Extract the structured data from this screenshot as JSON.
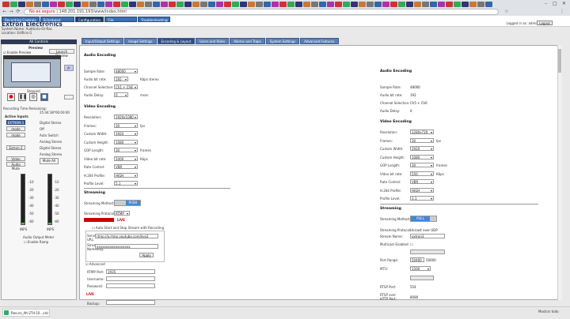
{
  "browser": {
    "security": "No es seguro",
    "url": "148.201.191.193/www/index.html"
  },
  "menubar": {
    "items": [
      "Recording Controls",
      "Scheduled Events",
      "Configuration",
      "File Management",
      "Troubleshooting"
    ],
    "active": "Configuration",
    "brand": "Extron Electronics",
    "logged_in": "Logged in as: admin",
    "logout": "Logout"
  },
  "system": {
    "name_label": "System Name:",
    "name_value": "Auditorio-Gt-Rac",
    "location_label": "Location:",
    "location_value": "Edificio G"
  },
  "subtabs": [
    "Input/Output Settings",
    "Image Settings",
    "Encoding & Layout",
    "Users and Roles",
    "Alarms and Traps",
    "System Settings",
    "Advanced Features"
  ],
  "subtabs_active": "Encoding & Layout",
  "sidebar": {
    "title": "All Controls",
    "preview_title": "Preview",
    "enable_preview": "Enable Preview",
    "launch_preview": "Launch Preview",
    "stopped": "Stopped",
    "rec_time_label": "Recording Time Remaining:",
    "rec_time_value": "25:44:38*00:00:00",
    "active_inputs": "Active Inputs",
    "input_rows": [
      {
        "btn": "EXTRON-1",
        "text": "Digital Stereo"
      },
      {
        "btn": "mode",
        "text": "Off"
      },
      {
        "btn": "mode",
        "text": "Auto Switch"
      },
      {
        "btn": "",
        "text": "Analog Stereo"
      },
      {
        "btn": "Extron-2",
        "text": "Digital Stereo"
      },
      {
        "btn": "",
        "text": "Analog Stereo"
      }
    ],
    "video_mute": "Video Mute",
    "audio_mute": "Audio Mute",
    "mute_all": "Mute All",
    "meter_scale": [
      "-10",
      "-20",
      "-30",
      "-40",
      "-50",
      "-60"
    ],
    "meter_labels": [
      "INPS",
      "INPS"
    ],
    "output_meter": "Audio Output Meter",
    "enable_ramp": "Enable Ramp",
    "meter_levels": [
      0.03,
      0.03
    ]
  },
  "left_enc": {
    "audio_title": "Audio Encoding",
    "audio": [
      {
        "label": "Sample Rate:",
        "value": "48000"
      },
      {
        "label": "Audio bit rate:",
        "value": "192",
        "unit": "Kbps stereo"
      },
      {
        "label": "Channel Selection:",
        "value": "Ch1 + Ch8"
      },
      {
        "label": "Audio Delay:",
        "value": "0",
        "unit": "msec"
      }
    ],
    "video_title": "Video Encoding",
    "video": [
      {
        "label": "Resolution:",
        "value": "1920x1080"
      },
      {
        "label": "Frames:",
        "value": "30",
        "unit": "fps"
      },
      {
        "label": "Custom Width:",
        "value": "1920"
      },
      {
        "label": "Custom Height:",
        "value": "1080"
      },
      {
        "label": "GOP Length:",
        "value": "30",
        "unit": "frames"
      },
      {
        "label": "Video bit rate:",
        "value": "5000",
        "unit": "Kbps"
      },
      {
        "label": "Rate Control:",
        "value": "VBR"
      },
      {
        "label": "H.264 Profile:",
        "value": "HIGH"
      },
      {
        "label": "Profile Level:",
        "value": "5.1"
      }
    ],
    "stream_title": "Streaming",
    "stream_method_label": "Streaming Method:",
    "stream_method": "PUSH",
    "stream_protocol_label": "Streaming Protocol:",
    "stream_protocol": "RTMP",
    "live_badge": "LIVE",
    "auto_start": "Auto Start and Stop Stream with Recording",
    "server_label": "Server URL:",
    "server_value": "rtmp://a.rtmp.youtube.com/live2",
    "stream_name_label": "Stream Name/Key:",
    "stream_name_value": "xxxxxxxxxxxxxxxxxx",
    "apply": "Apply",
    "advanced": "Advanced",
    "rtmp_port_label": "RTMP Port:",
    "rtmp_port": "1935",
    "username_label": "Username:",
    "password_label": "Password:",
    "live2": "LIVE",
    "backup_label": "Backup:"
  },
  "right_enc": {
    "audio_title": "Audio Encoding",
    "audio": [
      {
        "label": "Sample Rate:",
        "value": "48000"
      },
      {
        "label": "Audio bit rate:",
        "value": "192"
      },
      {
        "label": "Channel Selection:",
        "value": "Ch5 + Ch6"
      },
      {
        "label": "Audio Delay:",
        "value": "0"
      }
    ],
    "video_title": "Video Encoding",
    "video": [
      {
        "label": "Resolution:",
        "value": "1280x720"
      },
      {
        "label": "Frames:",
        "value": "30",
        "unit": "fps"
      },
      {
        "label": "Custom Width:",
        "value": "1920"
      },
      {
        "label": "Custom Height:",
        "value": "1080"
      },
      {
        "label": "GOP Length:",
        "value": "30",
        "unit": "frames"
      },
      {
        "label": "Video bit rate:",
        "value": "550",
        "unit": "Kbps"
      },
      {
        "label": "Rate Control:",
        "value": "VBR"
      },
      {
        "label": "H.264 Profile:",
        "value": "HIGH"
      },
      {
        "label": "Profile Level:",
        "value": "3.1"
      }
    ],
    "stream_title": "Streaming",
    "stream_method_label": "Streaming Method:",
    "stream_method": "PULL",
    "stream_protocol_label": "Streaming Protocol:",
    "stream_protocol": "Unicast over UDP",
    "stream_name_label": "Stream Name:",
    "stream_name": "extron3",
    "multicast_label": "Multicast Enabled:",
    "port_range_label": "Port Range:",
    "port_from": "50400",
    "port_to": "50600",
    "mtu_label": "MTU:",
    "mtu": "1500",
    "rtsp_port_label": "RTSP Port:",
    "rtsp_port": "554",
    "rtsp_http_label": "RTSP over HTTP Port:",
    "rtsp_http": "8080"
  },
  "taskbar": {
    "download": "Recurs_Alt-2Td-10...xlsl",
    "show_all": "Mostrar todo"
  }
}
